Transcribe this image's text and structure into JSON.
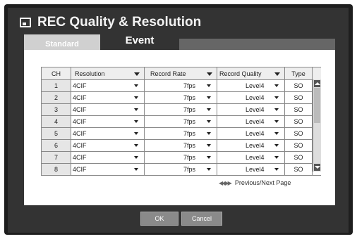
{
  "dialog": {
    "title": "REC Quality & Resolution",
    "icon": "screen-icon"
  },
  "tabs": {
    "standard": "Standard",
    "event": "Event",
    "active": "event"
  },
  "table": {
    "headers": [
      "CH",
      "Resolution",
      "Record Rate",
      "Record Quality",
      "Type"
    ],
    "rows": [
      {
        "ch": "1",
        "resolution": "4CIF",
        "rate": "7fps",
        "quality": "Level4",
        "type": "SO"
      },
      {
        "ch": "2",
        "resolution": "4CIF",
        "rate": "7fps",
        "quality": "Level4",
        "type": "SO"
      },
      {
        "ch": "3",
        "resolution": "4CIF",
        "rate": "7fps",
        "quality": "Level4",
        "type": "SO"
      },
      {
        "ch": "4",
        "resolution": "4CIF",
        "rate": "7fps",
        "quality": "Level4",
        "type": "SO"
      },
      {
        "ch": "5",
        "resolution": "4CIF",
        "rate": "7fps",
        "quality": "Level4",
        "type": "SO"
      },
      {
        "ch": "6",
        "resolution": "4CIF",
        "rate": "7fps",
        "quality": "Level4",
        "type": "SO"
      },
      {
        "ch": "7",
        "resolution": "4CIF",
        "rate": "7fps",
        "quality": "Level4",
        "type": "SO"
      },
      {
        "ch": "8",
        "resolution": "4CIF",
        "rate": "7fps",
        "quality": "Level4",
        "type": "SO"
      }
    ]
  },
  "pager": {
    "label": "Previous/Next Page",
    "icon": "double-chevron-icon"
  },
  "buttons": {
    "ok": "OK",
    "cancel": "Cancel"
  }
}
